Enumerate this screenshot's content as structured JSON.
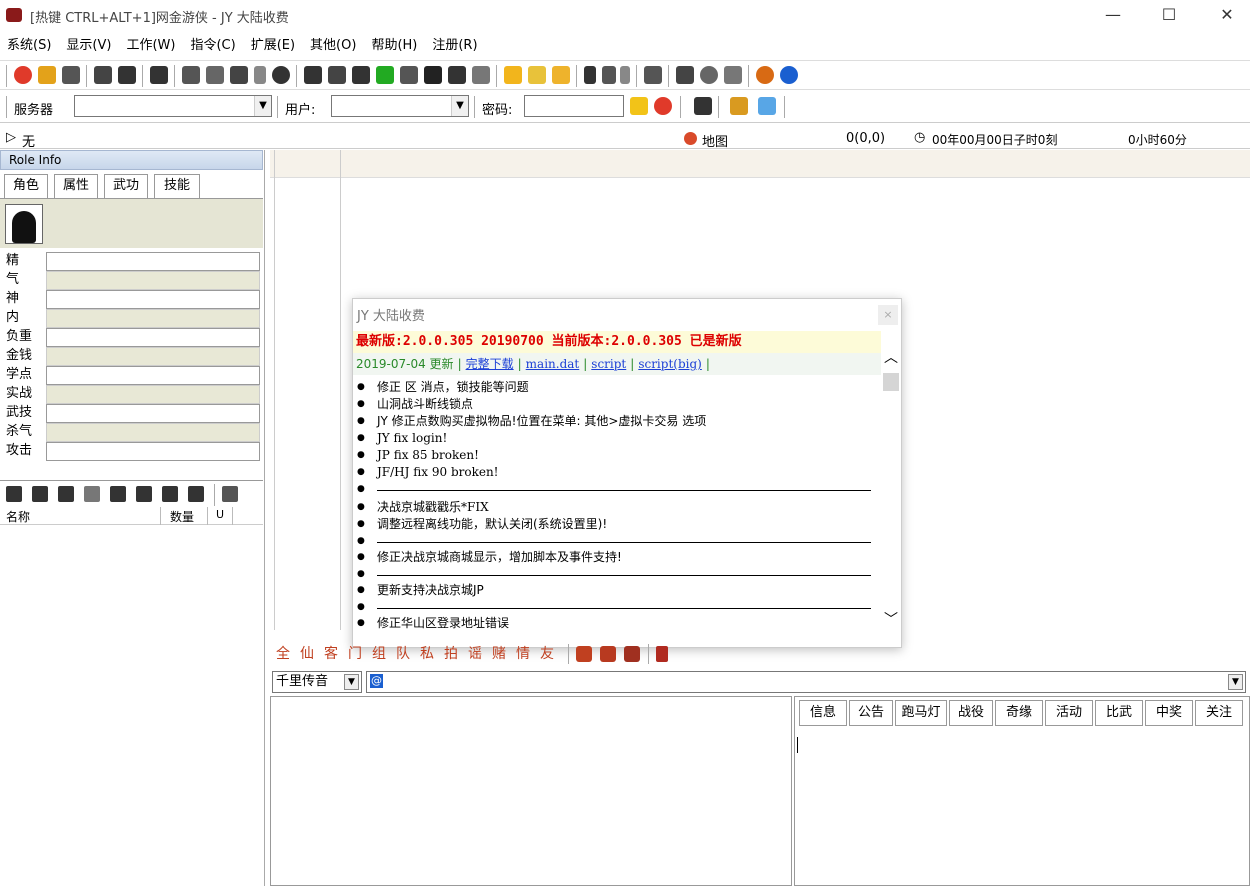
{
  "window": {
    "title": "[热键 CTRL+ALT+1]网金游侠 - JY 大陆收费",
    "minimize": "—",
    "maximize": "☐",
    "close": "✕"
  },
  "menu": [
    "系统(S)",
    "显示(V)",
    "工作(W)",
    "指令(C)",
    "扩展(E)",
    "其他(O)",
    "帮助(H)",
    "注册(R)"
  ],
  "login": {
    "server_label": "服务器",
    "server_value": "",
    "user_label": "用户:",
    "user_value": "",
    "password_label": "密码:",
    "password_value": ""
  },
  "status": {
    "target": "无",
    "map_label": "地图",
    "coords": "0(0,0)",
    "time": "00年00月00日子时0刻",
    "duration": "0小时60分"
  },
  "left_panel": {
    "header": "Role Info",
    "tabs": [
      "角色",
      "属性",
      "武功",
      "技能"
    ],
    "stats": [
      "精",
      "气",
      "神",
      "内",
      "负重",
      "金钱",
      "学点",
      "实战",
      "武技",
      "杀气",
      "攻击"
    ],
    "inventory_headers": {
      "name": "名称",
      "qty": "数量",
      "u": "U"
    }
  },
  "popup": {
    "title": "JY 大陆收费",
    "close": "×",
    "version_line": "最新版:2.0.0.305 20190700 当前版本:2.0.0.305 已是新版",
    "update_date": "2019-07-04 更新",
    "links": {
      "full_download": "完整下载",
      "main_dat": "main.dat",
      "script": "script",
      "script_big": "script(big)"
    },
    "notes_block1": [
      "修正 区 消点，锁技能等问题",
      "山洞战斗断线锁点",
      "JY 修正点数购买虚拟物品!位置在菜单: 其他>虚拟卡交易 选项",
      "JY fix login!",
      "JP fix 85 broken!",
      "JF/HJ fix 90 broken!"
    ],
    "notes_block2": [
      "决战京城戳戳乐*FIX",
      "调整远程离线功能，默认关闭(系统设置里)!"
    ],
    "notes_block3": "修正决战京城商城显示，增加脚本及事件支持!",
    "notes_block4": "更新支持决战京城JP",
    "notes_block5": "修正华山区登录地址错误"
  },
  "chat": {
    "channels_toolbar": [
      "全",
      "仙",
      "客",
      "门",
      "组",
      "队",
      "私",
      "拍",
      "谣",
      "赌",
      "情",
      "友"
    ],
    "channel_select": "千里传音",
    "input_value": "@"
  },
  "info_tabs": [
    "信息",
    "公告",
    "跑马灯",
    "战役",
    "奇缘",
    "活动",
    "比武",
    "中奖",
    "关注"
  ],
  "colors": {
    "version_red": "#dd0000",
    "link_blue": "#1b3fd6",
    "date_green": "#2a8a2a",
    "roleinfo_header": "#c7d6ea"
  }
}
